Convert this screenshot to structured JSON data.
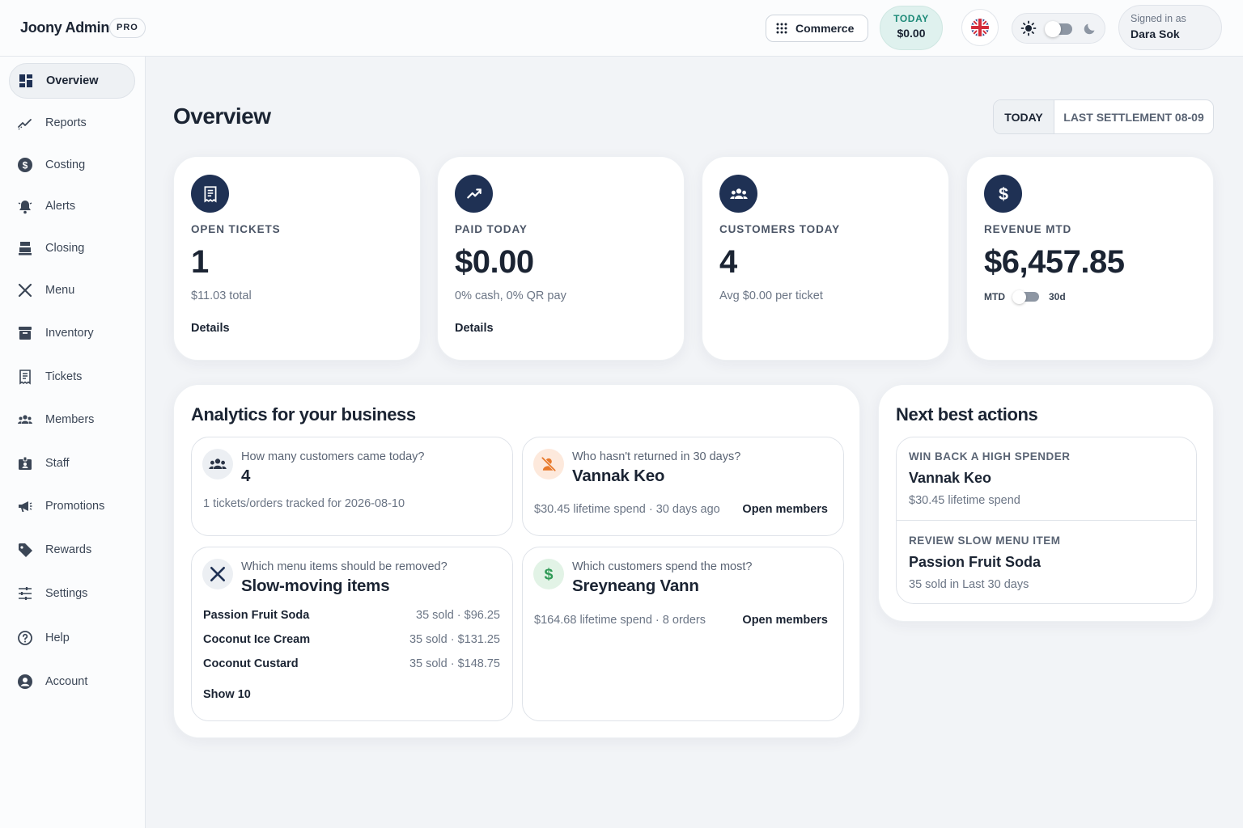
{
  "app": {
    "name": "Joony Admin",
    "badge": "PRO"
  },
  "topbar": {
    "commerce_label": "Commerce",
    "today_label": "TODAY",
    "today_value": "$0.00",
    "signed_in_label": "Signed in as",
    "user_name": "Dara Sok"
  },
  "sidebar": {
    "items": [
      {
        "label": "Overview",
        "icon": "grid-icon",
        "active": true
      },
      {
        "label": "Reports",
        "icon": "trend-icon"
      },
      {
        "label": "Costing",
        "icon": "dollar-icon"
      },
      {
        "label": "Alerts",
        "icon": "bell-icon"
      },
      {
        "label": "Closing",
        "icon": "register-icon"
      },
      {
        "label": "Menu",
        "icon": "utensils-icon"
      },
      {
        "label": "Inventory",
        "icon": "archive-icon"
      },
      {
        "label": "Tickets",
        "icon": "receipt-icon"
      },
      {
        "label": "Members",
        "icon": "group-icon"
      },
      {
        "label": "Staff",
        "icon": "badge-icon"
      },
      {
        "label": "Promotions",
        "icon": "megaphone-icon"
      },
      {
        "label": "Rewards",
        "icon": "tag-icon"
      },
      {
        "label": "Settings",
        "icon": "sliders-icon"
      },
      {
        "label": "Help",
        "icon": "help-icon"
      },
      {
        "label": "Account",
        "icon": "user-icon"
      }
    ]
  },
  "main": {
    "title": "Overview",
    "range": {
      "today": "TODAY",
      "last": "LAST SETTLEMENT 08-09"
    },
    "kpis": [
      {
        "label": "OPEN TICKETS",
        "value": "1",
        "sub": "$11.03 total",
        "link": "Details",
        "icon": "receipt-icon"
      },
      {
        "label": "PAID TODAY",
        "value": "$0.00",
        "sub": "0% cash, 0% QR pay",
        "link": "Details",
        "icon": "trend-icon"
      },
      {
        "label": "CUSTOMERS TODAY",
        "value": "4",
        "sub": "Avg $0.00 per ticket",
        "icon": "group-icon"
      },
      {
        "label": "REVENUE MTD",
        "value": "$6,457.85",
        "toggle_left": "MTD",
        "toggle_right": "30d",
        "icon": "dollar-icon"
      }
    ]
  },
  "analytics": {
    "title": "Analytics for your business",
    "customers_today": {
      "question": "How many customers came today?",
      "answer": "4",
      "meta": "1 tickets/orders tracked for 2026-08-10"
    },
    "not_returned": {
      "question": "Who hasn't returned in 30 days?",
      "answer": "Vannak Keo",
      "meta": "$30.45 lifetime spend · 30 days ago",
      "link": "Open members"
    },
    "slow_items": {
      "question": "Which menu items should be removed?",
      "answer": "Slow-moving items",
      "rows": [
        {
          "name": "Passion Fruit Soda",
          "stat": "35 sold · $96.25"
        },
        {
          "name": "Coconut Ice Cream",
          "stat": "35 sold · $131.25"
        },
        {
          "name": "Coconut Custard",
          "stat": "35 sold · $148.75"
        }
      ],
      "link": "Show 10"
    },
    "top_spender": {
      "question": "Which customers spend the most?",
      "answer": "Sreyneang Vann",
      "meta": "$164.68 lifetime spend · 8 orders",
      "link": "Open members"
    }
  },
  "next_actions": {
    "title": "Next best actions",
    "items": [
      {
        "kicker": "WIN BACK A HIGH SPENDER",
        "name": "Vannak Keo",
        "detail": "$30.45 lifetime spend"
      },
      {
        "kicker": "REVIEW SLOW MENU ITEM",
        "name": "Passion Fruit Soda",
        "detail": "35 sold in Last 30 days"
      }
    ]
  },
  "colors": {
    "accent_navy": "#1f3154",
    "today_green": "#1d8a78",
    "warning_orange": "#e8792b",
    "money_green": "#2f9a56"
  }
}
